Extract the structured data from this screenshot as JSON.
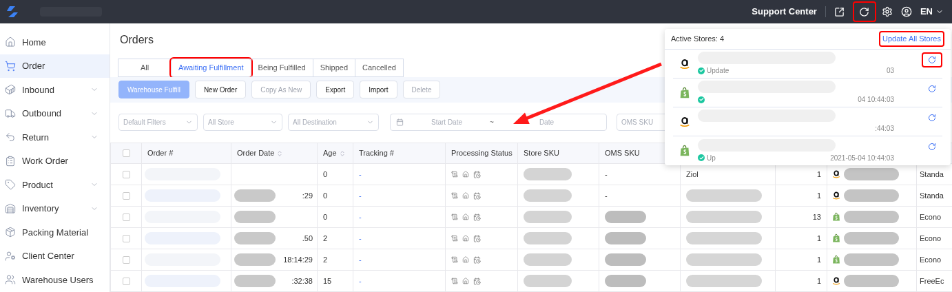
{
  "header": {
    "support_link": "Support Center",
    "refresh_highlighted": true,
    "language": "EN"
  },
  "sidebar": {
    "items": [
      {
        "label": "Home",
        "selected": false,
        "expandable": false
      },
      {
        "label": "Order",
        "selected": true,
        "expandable": false
      },
      {
        "label": "Inbound",
        "selected": false,
        "expandable": true
      },
      {
        "label": "Outbound",
        "selected": false,
        "expandable": true
      },
      {
        "label": "Return",
        "selected": false,
        "expandable": true
      },
      {
        "label": "Work Order",
        "selected": false,
        "expandable": false
      },
      {
        "label": "Product",
        "selected": false,
        "expandable": true
      },
      {
        "label": "Inventory",
        "selected": false,
        "expandable": true
      },
      {
        "label": "Packing Material",
        "selected": false,
        "expandable": false
      },
      {
        "label": "Client Center",
        "selected": false,
        "expandable": false
      },
      {
        "label": "Warehouse Users",
        "selected": false,
        "expandable": false
      }
    ]
  },
  "page_title": "Orders",
  "tabs": [
    {
      "label": "All",
      "selected": false,
      "highlighted": false
    },
    {
      "label": "Awaiting Fulfillment",
      "selected": true,
      "highlighted": true
    },
    {
      "label": "Being Fulfilled",
      "selected": false,
      "highlighted": false
    },
    {
      "label": "Shipped",
      "selected": false,
      "highlighted": false
    },
    {
      "label": "Cancelled",
      "selected": false,
      "highlighted": false
    }
  ],
  "toolbar": [
    {
      "label": "Warehouse Fulfill",
      "kind": "primary",
      "disabled": true
    },
    {
      "label": "New Order",
      "kind": "default",
      "disabled": false
    },
    {
      "label": "Copy As New",
      "kind": "default",
      "disabled": true
    },
    {
      "label": "Export",
      "kind": "default",
      "disabled": false
    },
    {
      "label": "Import",
      "kind": "default",
      "disabled": false
    },
    {
      "label": "Delete",
      "kind": "default",
      "disabled": true
    }
  ],
  "filters": [
    {
      "kind": "select",
      "placeholder": "Default Filters"
    },
    {
      "kind": "select",
      "placeholder": "All Store"
    },
    {
      "kind": "select",
      "placeholder": "All Destination"
    },
    {
      "kind": "date-range",
      "start_placeholder": "Start Date",
      "separator": "~",
      "end_placeholder": "Date"
    },
    {
      "kind": "text",
      "placeholder": "OMS SKU"
    }
  ],
  "table": {
    "header_checked": false,
    "columns": [
      {
        "kind": "checkbox"
      },
      {
        "label": "Order #",
        "sortable": false
      },
      {
        "label": "Order Date",
        "sortable": true
      },
      {
        "label": "Age",
        "sortable": true
      },
      {
        "label": "Tracking #",
        "sortable": false
      },
      {
        "label": "Processing Status",
        "sortable": false
      },
      {
        "label": "Store SKU",
        "sortable": false
      },
      {
        "label": "OMS SKU",
        "sortable": false
      }
    ],
    "rows": [
      {
        "checked": false,
        "age": "0",
        "tracking": "-",
        "oms_sku": "-",
        "column_9": "Ziol",
        "quantity": "1",
        "kind": "amazon",
        "shipping": "Standa"
      },
      {
        "checked": false,
        "order_date": ":29",
        "age": "0",
        "tracking": "-",
        "oms_sku": "-",
        "quantity": "1",
        "kind": "amazon",
        "shipping": "Standa"
      },
      {
        "checked": false,
        "age": "0",
        "tracking": "-",
        "quantity": "13",
        "kind": "shopify",
        "shipping": "Econo"
      },
      {
        "checked": false,
        "order_date": ".50",
        "age": "2",
        "tracking": "-",
        "quantity": "1",
        "kind": "shopify",
        "shipping": "Econo"
      },
      {
        "checked": false,
        "order_date": "18:14:29",
        "age": "2",
        "tracking": "-",
        "quantity": "1",
        "kind": "shopify",
        "shipping": "Econo"
      },
      {
        "checked": false,
        "order_date": ":32:38",
        "age": "15",
        "tracking": "-",
        "quantity": "1",
        "kind": "amazon",
        "shipping": "FreeEc"
      }
    ]
  },
  "stores_popup": {
    "title": "Active Stores: 4",
    "update_all": "Update All Stores",
    "update_all_highlighted": true,
    "stores": [
      {
        "kind": "amazon",
        "status": "Update",
        "updated": "03",
        "synced": true,
        "highlighted": true
      },
      {
        "kind": "shopify",
        "updated": "04 10:44:03",
        "synced": true,
        "highlighted": false
      },
      {
        "kind": "amazon",
        "updated": ":44:03",
        "synced": false,
        "highlighted": false
      },
      {
        "kind": "shopify",
        "status": "Up",
        "updated": "2021-05-04 10:44:03",
        "synced": true,
        "highlighted": false
      }
    ]
  }
}
